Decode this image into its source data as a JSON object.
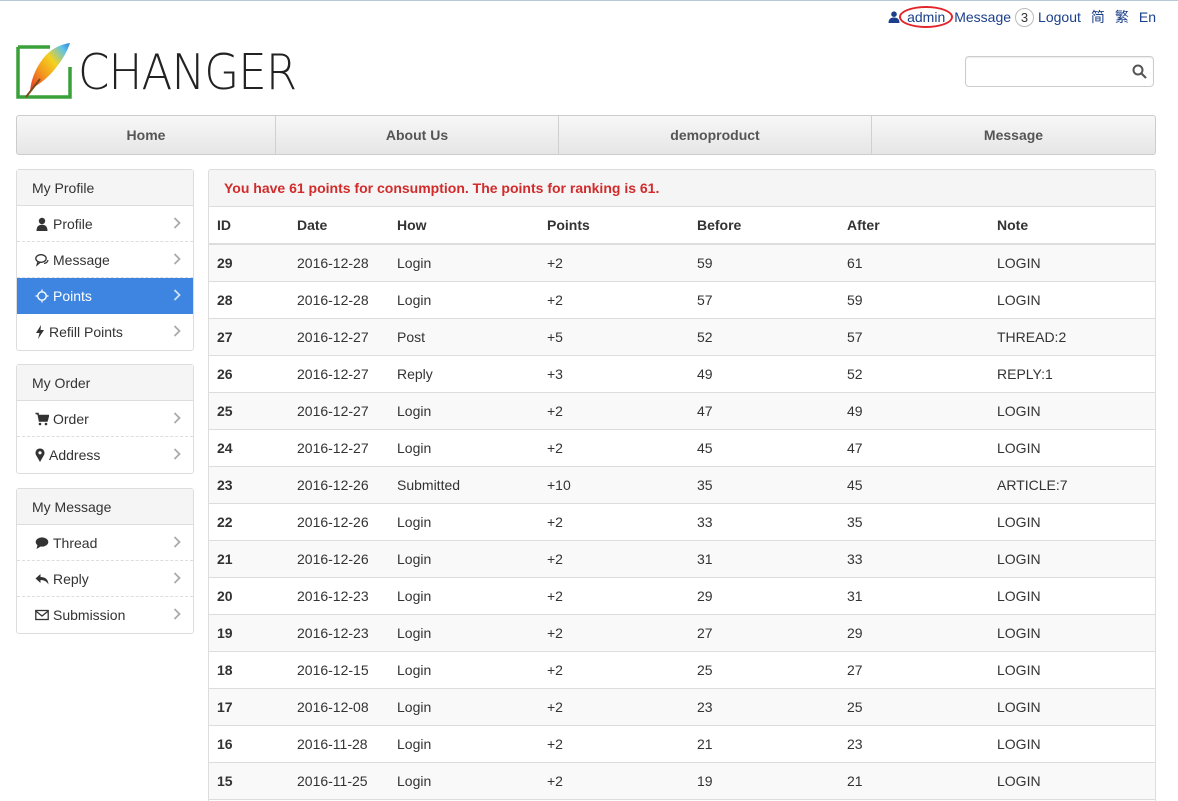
{
  "topbar": {
    "user": "admin",
    "message_label": "Message",
    "message_count": "3",
    "logout_label": "Logout",
    "lang_simplified": "简",
    "lang_traditional": "繁",
    "lang_english": "En"
  },
  "brand": {
    "name": "CHANGER"
  },
  "search": {
    "placeholder": ""
  },
  "nav": [
    {
      "label": "Home"
    },
    {
      "label": "About Us"
    },
    {
      "label": "demoproduct"
    },
    {
      "label": "Message"
    }
  ],
  "sidebar": {
    "profile": {
      "title": "My Profile",
      "items": [
        {
          "label": "Profile",
          "icon": "user-icon"
        },
        {
          "label": "Message",
          "icon": "comments-icon"
        },
        {
          "label": "Points",
          "icon": "sun-icon"
        },
        {
          "label": "Refill Points",
          "icon": "bolt-icon"
        }
      ]
    },
    "order": {
      "title": "My Order",
      "items": [
        {
          "label": "Order",
          "icon": "cart-icon"
        },
        {
          "label": "Address",
          "icon": "map-marker-icon"
        }
      ]
    },
    "message": {
      "title": "My Message",
      "items": [
        {
          "label": "Thread",
          "icon": "comment-icon"
        },
        {
          "label": "Reply",
          "icon": "reply-icon"
        },
        {
          "label": "Submission",
          "icon": "envelope-icon"
        }
      ]
    }
  },
  "points": {
    "notice": "You have 61 points for consumption. The points for ranking is 61.",
    "columns": [
      "ID",
      "Date",
      "How",
      "Points",
      "Before",
      "After",
      "Note"
    ],
    "rows": [
      [
        "29",
        "2016-12-28",
        "Login",
        "+2",
        "59",
        "61",
        "LOGIN"
      ],
      [
        "28",
        "2016-12-28",
        "Login",
        "+2",
        "57",
        "59",
        "LOGIN"
      ],
      [
        "27",
        "2016-12-27",
        "Post",
        "+5",
        "52",
        "57",
        "THREAD:2"
      ],
      [
        "26",
        "2016-12-27",
        "Reply",
        "+3",
        "49",
        "52",
        "REPLY:1"
      ],
      [
        "25",
        "2016-12-27",
        "Login",
        "+2",
        "47",
        "49",
        "LOGIN"
      ],
      [
        "24",
        "2016-12-27",
        "Login",
        "+2",
        "45",
        "47",
        "LOGIN"
      ],
      [
        "23",
        "2016-12-26",
        "Submitted",
        "+10",
        "35",
        "45",
        "ARTICLE:7"
      ],
      [
        "22",
        "2016-12-26",
        "Login",
        "+2",
        "33",
        "35",
        "LOGIN"
      ],
      [
        "21",
        "2016-12-26",
        "Login",
        "+2",
        "31",
        "33",
        "LOGIN"
      ],
      [
        "20",
        "2016-12-23",
        "Login",
        "+2",
        "29",
        "31",
        "LOGIN"
      ],
      [
        "19",
        "2016-12-23",
        "Login",
        "+2",
        "27",
        "29",
        "LOGIN"
      ],
      [
        "18",
        "2016-12-15",
        "Login",
        "+2",
        "25",
        "27",
        "LOGIN"
      ],
      [
        "17",
        "2016-12-08",
        "Login",
        "+2",
        "23",
        "25",
        "LOGIN"
      ],
      [
        "16",
        "2016-11-28",
        "Login",
        "+2",
        "21",
        "23",
        "LOGIN"
      ],
      [
        "15",
        "2016-11-25",
        "Login",
        "+2",
        "19",
        "21",
        "LOGIN"
      ]
    ]
  },
  "colors": {
    "accent": "#3d85e0",
    "notice": "#d12b2b",
    "link": "#1b3f8b",
    "highlight_ring": "#e0252b"
  }
}
